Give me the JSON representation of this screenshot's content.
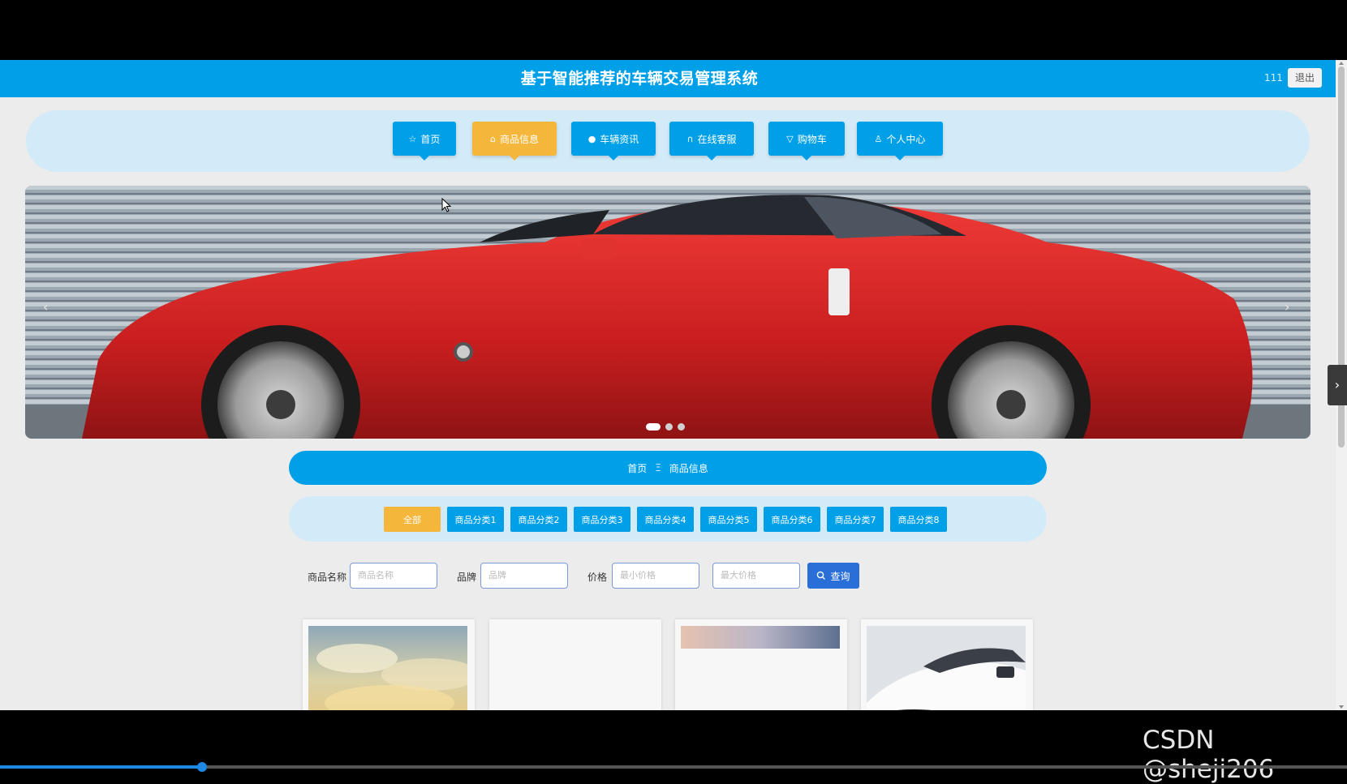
{
  "header": {
    "title": "基于智能推荐的车辆交易管理系统",
    "username": "111",
    "logout_label": "退出"
  },
  "nav": {
    "items": [
      {
        "label": "首页",
        "icon": "star-icon",
        "glyph": "☆",
        "active": false
      },
      {
        "label": "商品信息",
        "icon": "bag-icon",
        "glyph": "⌂",
        "active": true
      },
      {
        "label": "车辆资讯",
        "icon": "info-icon",
        "glyph": "●",
        "active": false
      },
      {
        "label": "在线客服",
        "icon": "headset-icon",
        "glyph": "∩",
        "active": false
      },
      {
        "label": "购物车",
        "icon": "cart-icon",
        "glyph": "▽",
        "active": false
      },
      {
        "label": "个人中心",
        "icon": "user-icon",
        "glyph": "♙",
        "active": false
      }
    ]
  },
  "banner": {
    "prev_glyph": "‹",
    "next_glyph": "›",
    "slide_count": 3,
    "active_slide": 0
  },
  "breadcrumb": {
    "home": "首页",
    "separator": "Ξ",
    "current": "商品信息"
  },
  "categories": {
    "items": [
      "全部",
      "商品分类1",
      "商品分类2",
      "商品分类3",
      "商品分类4",
      "商品分类5",
      "商品分类6",
      "商品分类7",
      "商品分类8"
    ],
    "active_index": 0
  },
  "search": {
    "name_label": "商品名称",
    "name_placeholder": "商品名称",
    "brand_label": "品牌",
    "brand_placeholder": "品牌",
    "price_label": "价格",
    "min_price_placeholder": "最小价格",
    "max_price_placeholder": "最大价格",
    "query_label": "查询"
  },
  "side_tab": {
    "glyph": "›"
  },
  "watermark": "CSDN @sheji206",
  "video_progress": 0.15,
  "colors": {
    "primary": "#00a0e9",
    "accent": "#f5b73b",
    "query_button": "#2a6ed8",
    "light_panel": "#d3ebf8"
  }
}
